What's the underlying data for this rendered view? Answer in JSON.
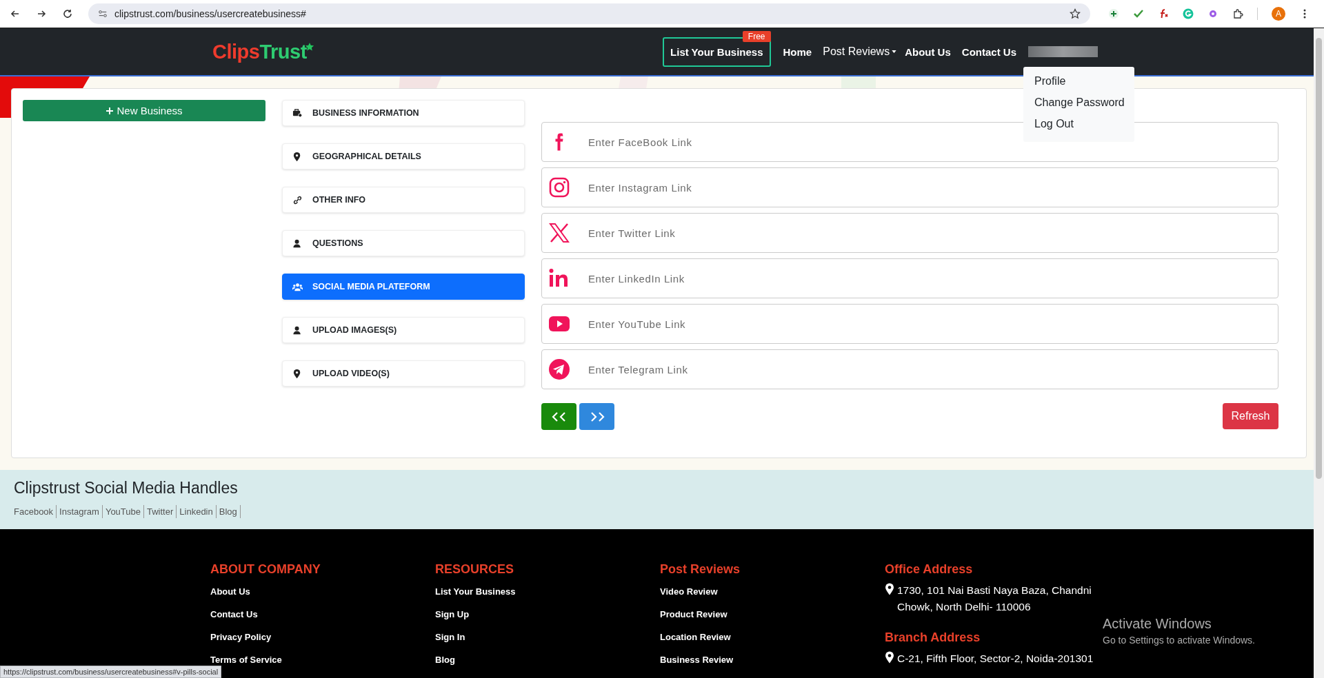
{
  "browser": {
    "url": "clipstrust.com/business/usercreatebusiness#",
    "avatar": "A",
    "status_url": "https://clipstrust.com/business/usercreatebusiness#v-pills-social"
  },
  "header": {
    "logo": {
      "first": "Clips",
      "second": "Trust"
    },
    "nav": [
      {
        "kind": "boxed",
        "label": "List Your Business",
        "badge": "Free"
      },
      {
        "kind": "bold",
        "label": "Home"
      },
      {
        "kind": "dropdown",
        "label": "Post Reviews"
      },
      {
        "kind": "bold",
        "label": "About Us"
      },
      {
        "kind": "bold",
        "label": "Contact Us"
      },
      {
        "kind": "hidden-user"
      }
    ],
    "user_menu": [
      "Profile",
      "Change Password",
      "Log Out"
    ]
  },
  "new_business_button": "New Business",
  "tabs": [
    {
      "label": "BUSINESS INFORMATION",
      "selected": false
    },
    {
      "label": "GEOGRAPHICAL DETAILS",
      "selected": false
    },
    {
      "label": "OTHER INFO",
      "selected": false
    },
    {
      "label": "QUESTIONS",
      "selected": false
    },
    {
      "label": "SOCIAL MEDIA PLATEFORM",
      "selected": true
    },
    {
      "label": "UPLOAD IMAGES(S)",
      "selected": false
    },
    {
      "label": "UPLOAD VIDEO(S)",
      "selected": false
    }
  ],
  "social_fields": [
    {
      "placeholder": "Enter FaceBook Link"
    },
    {
      "placeholder": "Enter Instagram Link"
    },
    {
      "placeholder": "Enter Twitter Link"
    },
    {
      "placeholder": "Enter LinkedIn Link"
    },
    {
      "placeholder": "Enter YouTube Link"
    },
    {
      "placeholder": "Enter Telegram Link"
    }
  ],
  "refresh_button": "Refresh",
  "handles": {
    "title": "Clipstrust Social Media Handles",
    "links": [
      "Facebook",
      "Instagram",
      "YouTube",
      "Twitter",
      "Linkedin",
      "Blog"
    ]
  },
  "footer": {
    "columns": [
      {
        "heading": "ABOUT COMPANY",
        "links": [
          "About Us",
          "Contact Us",
          "Privacy Policy",
          "Terms of Service"
        ]
      },
      {
        "heading": "RESOURCES",
        "links": [
          "List Your Business",
          "Sign Up",
          "Sign In",
          "Blog"
        ]
      },
      {
        "heading": "Post Reviews",
        "links": [
          "Video Review",
          "Product Review",
          "Location Review",
          "Business Review"
        ]
      }
    ],
    "addresses": [
      {
        "heading": "Office Address",
        "text": "1730, 101 Nai Basti Naya Baza, Chandni Chowk, North Delhi- 110006"
      },
      {
        "heading": "Branch Address",
        "text": "C-21, Fifth Floor, Sector-2, Noida-201301"
      }
    ]
  },
  "os_notice": {
    "title": "Activate Windows",
    "subtitle": "Go to Settings to activate Windows."
  }
}
